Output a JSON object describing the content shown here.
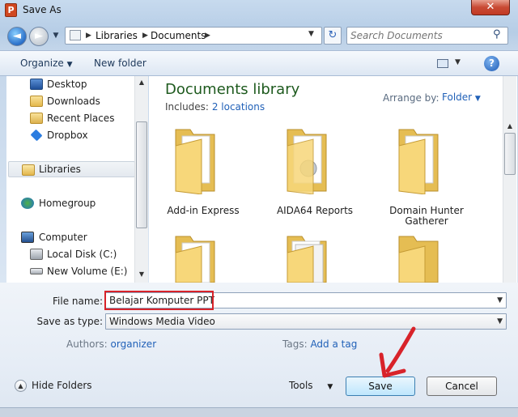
{
  "window": {
    "title": "Save As",
    "app_icon_letter": "P",
    "close_glyph": "✕"
  },
  "nav": {
    "back_glyph": "◄",
    "forward_glyph": "►"
  },
  "address": {
    "crumbs": [
      "Libraries",
      "Documents"
    ]
  },
  "search": {
    "placeholder": "Search Documents"
  },
  "toolbar": {
    "organize": "Organize",
    "new_folder": "New folder",
    "help_glyph": "?"
  },
  "sidebar": {
    "items": [
      {
        "label": "Desktop",
        "icon": "desktop-icon"
      },
      {
        "label": "Downloads",
        "icon": "downloads-folder-icon"
      },
      {
        "label": "Recent Places",
        "icon": "recent-places-icon"
      },
      {
        "label": "Dropbox",
        "icon": "dropbox-icon"
      },
      {
        "label": "Libraries",
        "icon": "libraries-icon",
        "selected": true
      },
      {
        "label": "Homegroup",
        "icon": "homegroup-icon"
      },
      {
        "label": "Computer",
        "icon": "computer-icon"
      },
      {
        "label": "Local Disk (C:)",
        "icon": "local-disk-icon"
      },
      {
        "label": "New Volume (E:)",
        "icon": "drive-icon"
      }
    ]
  },
  "library": {
    "title": "Documents library",
    "includes_label": "Includes:",
    "includes_link": "2 locations",
    "arrange_label": "Arrange by:",
    "arrange_value": "Folder"
  },
  "folders": [
    {
      "name": "Add-in Express"
    },
    {
      "name": "AIDA64 Reports"
    },
    {
      "name": "Domain Hunter Gatherer"
    }
  ],
  "form": {
    "file_name_label": "File name:",
    "file_name_value": "Belajar Komputer PPT",
    "save_type_label": "Save as type:",
    "save_type_value": "Windows Media Video",
    "authors_label": "Authors:",
    "authors_value": "organizer",
    "tags_label": "Tags:",
    "tags_value": "Add a tag"
  },
  "footer": {
    "hide_folders": "Hide Folders",
    "tools": "Tools",
    "save": "Save",
    "cancel": "Cancel"
  },
  "colors": {
    "annotation_red": "#d8232a",
    "link_blue": "#2161b8",
    "library_title_green": "#1e5a1e"
  }
}
